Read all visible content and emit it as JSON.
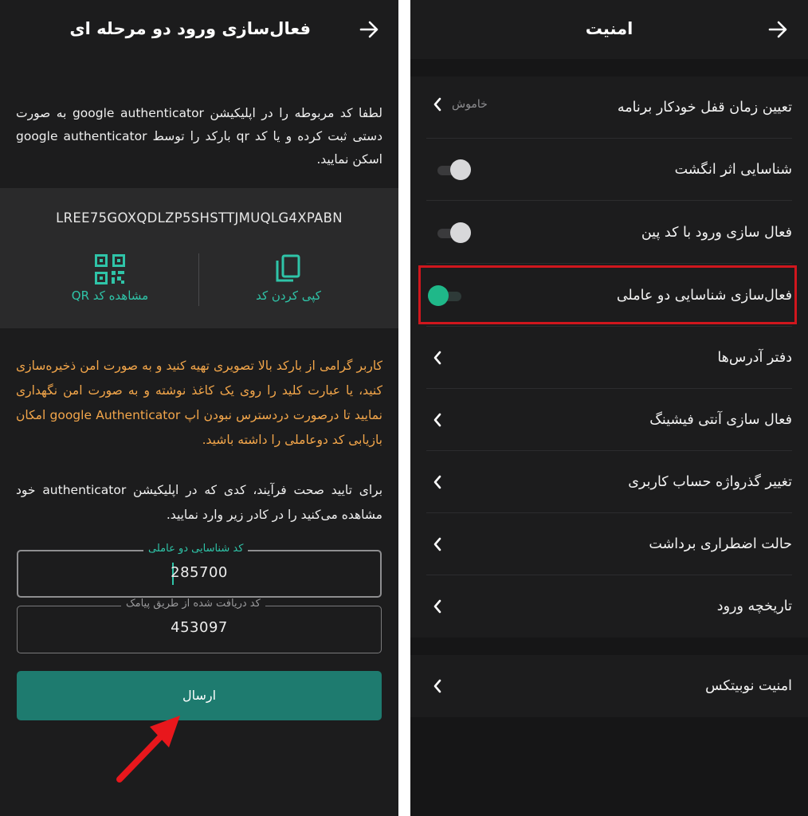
{
  "left_screen": {
    "header": {
      "title": "فعال‌سازی ورود دو مرحله ای"
    },
    "instructions": "لطفا کد مربوطه را در اپلیکیشن google authenticator به صورت دستی ثبت کرده و یا کد qr بارکد را توسط google authenticator اسکن نمایید.",
    "secret_key": "LREE75GOXQDLZP5SHSTTJMUQLG4XPABN",
    "copy_label": "کپی کردن کد",
    "qr_label": "مشاهده کد QR",
    "warning": "کاربر گرامی از بارکد بالا تصویری تهیه کنید و به صورت امن ذخیره‌سازی کنید، یا عبارت کلید را روی یک کاغذ نوشته و به صورت امن نگهداری نمایید تا درصورت دردسترس نبودن اپ google Authenticator امکان بازیابی کد دوعاملی را داشته باشید.",
    "verify_instructions": "برای تایید صحت فرآیند، کدی که در اپلیکیشن authenticator خود مشاهده می‌کنید را در کادر زیر وارد نمایید.",
    "two_factor_field": {
      "label": "کد شناسایی دو عاملی",
      "value": "285700"
    },
    "sms_field": {
      "label": "کد دریافت شده از طریق پیامک",
      "value": "453097"
    },
    "submit_label": "ارسال"
  },
  "right_screen": {
    "header": {
      "title": "امنیت"
    },
    "items": [
      {
        "label": "تعیین زمان قفل خودکار برنامه",
        "value": "خاموش"
      },
      {
        "label": "شناسایی اثر انگشت",
        "toggle": "off"
      },
      {
        "label": "فعال سازی ورود با کد پین",
        "toggle": "off"
      },
      {
        "label": "فعال‌سازی شناسایی دو عاملی",
        "toggle": "on"
      },
      {
        "label": "دفتر آدرس‌ها"
      },
      {
        "label": "فعال سازی آنتی فیشینگ"
      },
      {
        "label": "تغییر گذرواژه حساب کاربری"
      },
      {
        "label": "حالت اضطراری برداشت"
      },
      {
        "label": "تاریخچه ورود"
      }
    ],
    "footer_item": {
      "label": "امنیت نوبیتکس"
    }
  },
  "colors": {
    "background": "#1c1c1d",
    "accent": "#2fc4a8",
    "button": "#1e7b6f",
    "warning_text": "#f3a64a",
    "highlight": "#d0161d",
    "annotation_arrow": "#e8171c"
  }
}
